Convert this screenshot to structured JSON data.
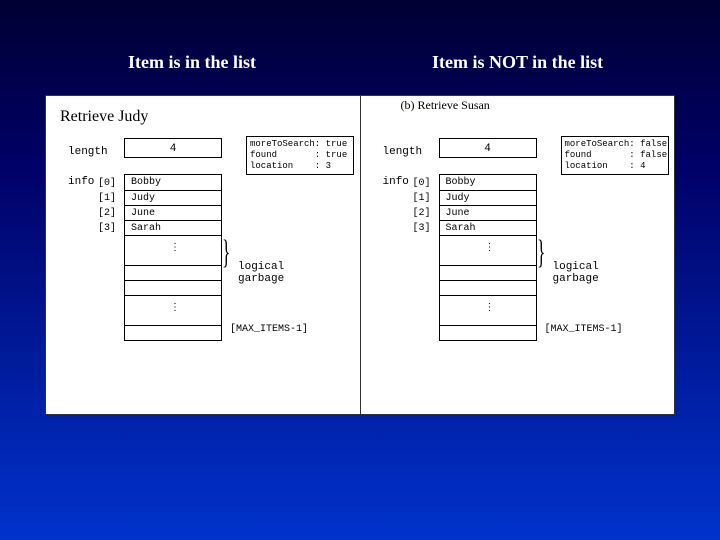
{
  "titles": {
    "left": "Item is in the list",
    "right": "Item is NOT in the list"
  },
  "retrieve_label": "Retrieve Judy",
  "panel_a": {
    "caption": "",
    "length_label": "length",
    "length_value": "4",
    "state_line1": "moreToSearch: true",
    "state_line2": "found       : true",
    "state_line3": "location    : 3",
    "info_label": "info",
    "indices": "[0]\n[1]\n[2]\n[3]",
    "rows": [
      "Bobby",
      "Judy",
      "June",
      "Sarah"
    ],
    "garbage_label": "logical\ngarbage",
    "max_label": "[MAX_ITEMS-1]"
  },
  "panel_b": {
    "caption": "(b) Retrieve Susan",
    "length_label": "length",
    "length_value": "4",
    "state_line1": "moreToSearch: false",
    "state_line2": "found       : false",
    "state_line3": "location    : 4",
    "info_label": "info",
    "indices": "[0]\n[1]\n[2]\n[3]",
    "rows": [
      "Bobby",
      "Judy",
      "June",
      "Sarah"
    ],
    "garbage_label": "logical\ngarbage",
    "max_label": "[MAX_ITEMS-1]"
  }
}
